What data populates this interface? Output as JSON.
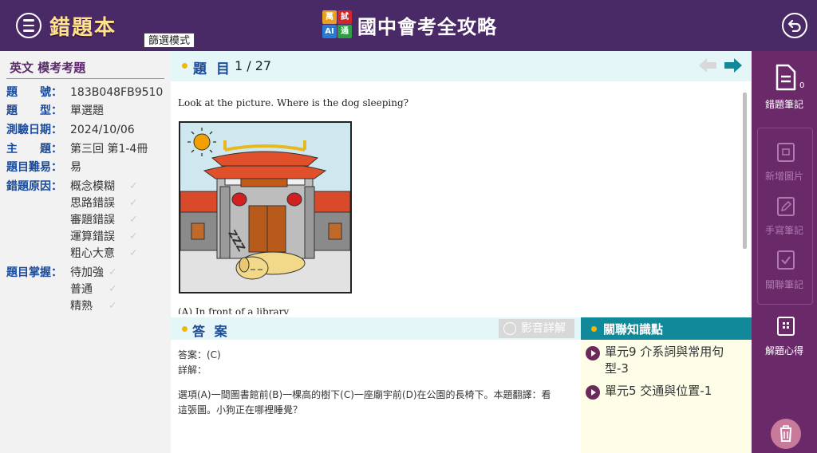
{
  "header": {
    "page_title": "錯題本",
    "mode_tag": "篩選模式",
    "logo_chars": [
      "萬",
      "試",
      "AI",
      "通"
    ],
    "app_title": "國中會考全攻略"
  },
  "info": {
    "subject": "英文 模考考題",
    "rows": [
      {
        "label": "題　　號：",
        "value": "183B048FB9510"
      },
      {
        "label": "題　　型：",
        "value": "單選題"
      },
      {
        "label": "測驗日期：",
        "value": "2024/10/06"
      },
      {
        "label": "主　　題：",
        "value": "第三回 第1-4冊"
      },
      {
        "label": "題目難易：",
        "value": "易"
      }
    ],
    "reason_label": "錯題原因：",
    "reasons": [
      "概念模糊",
      "思路錯誤",
      "審題錯誤",
      "運算錯誤",
      "粗心大意"
    ],
    "mastery_label": "題目掌握：",
    "mastery": [
      "待加強",
      "普通",
      "精熟"
    ]
  },
  "question": {
    "title": "題 目",
    "count": "1 / 27",
    "text": "Look at the picture. Where is the dog sleeping?",
    "option_a": "(A) In front of a library"
  },
  "answer": {
    "title": "答 案",
    "video_label": "影音詳解",
    "answer_line": "答案：(C)",
    "explain_label": "詳解：",
    "explain_text_1": "選項(A)一間圖書館前(B)一棵高的樹下(C)一座廟宇前(D)在公園的長椅下。本題翻譯：看",
    "explain_text_2": "這張圖。小狗正在哪裡睡覺？"
  },
  "knowledge": {
    "title": "關聯知識點",
    "items": [
      {
        "text": "單元9 介系詞與常用句型-3"
      },
      {
        "text": "單元5 交通與位置-1"
      }
    ]
  },
  "sidebar": {
    "note_label": "錯題筆記",
    "note_count": "0",
    "add_image_label": "新增圖片",
    "handwrite_label": "手寫筆記",
    "related_label": "關聯筆記",
    "insight_label": "解題心得"
  },
  "colors": {
    "header_bg": "#4a2a66",
    "title_yellow": "#ffe28a",
    "label_blue": "#1a4a9a",
    "teal": "#12899a",
    "sidebar": "#6a2a6a"
  }
}
